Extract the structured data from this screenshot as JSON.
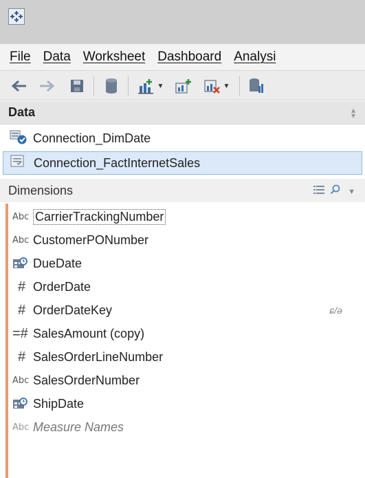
{
  "menubar": {
    "items": [
      "File",
      "Data",
      "Worksheet",
      "Dashboard",
      "Analysi"
    ]
  },
  "toolbar": {
    "icons": [
      "back-icon",
      "forward-icon",
      "save-icon",
      "database-icon",
      "new-worksheet-icon",
      "new-dashboard-icon",
      "clear-sheet-icon",
      "data-source-icon"
    ]
  },
  "data_pane": {
    "title": "Data",
    "connections": [
      "Connection_DimDate",
      "Connection_FactInternetSales"
    ],
    "selected_connection": "Connection_FactInternetSales"
  },
  "dimensions": {
    "title": "Dimensions",
    "fields": [
      {
        "type": "Abc",
        "name": "CarrierTrackingNumber"
      },
      {
        "type": "Abc",
        "name": "CustomerPONumber"
      },
      {
        "type": "date",
        "name": "DueDate"
      },
      {
        "type": "#",
        "name": "OrderDate"
      },
      {
        "type": "#",
        "name": "OrderDateKey",
        "annotation": "ɕ/ə"
      },
      {
        "type": "=#",
        "name": "SalesAmount (copy)"
      },
      {
        "type": "#",
        "name": "SalesOrderLineNumber"
      },
      {
        "type": "Abc",
        "name": "SalesOrderNumber"
      },
      {
        "type": "date",
        "name": "ShipDate"
      },
      {
        "type": "Abc",
        "name": "Measure Names"
      }
    ]
  },
  "colors": {
    "accent_bar": "#e89a73",
    "selected_bg": "#dbe9f8",
    "selected_border": "#8fb8e0"
  }
}
